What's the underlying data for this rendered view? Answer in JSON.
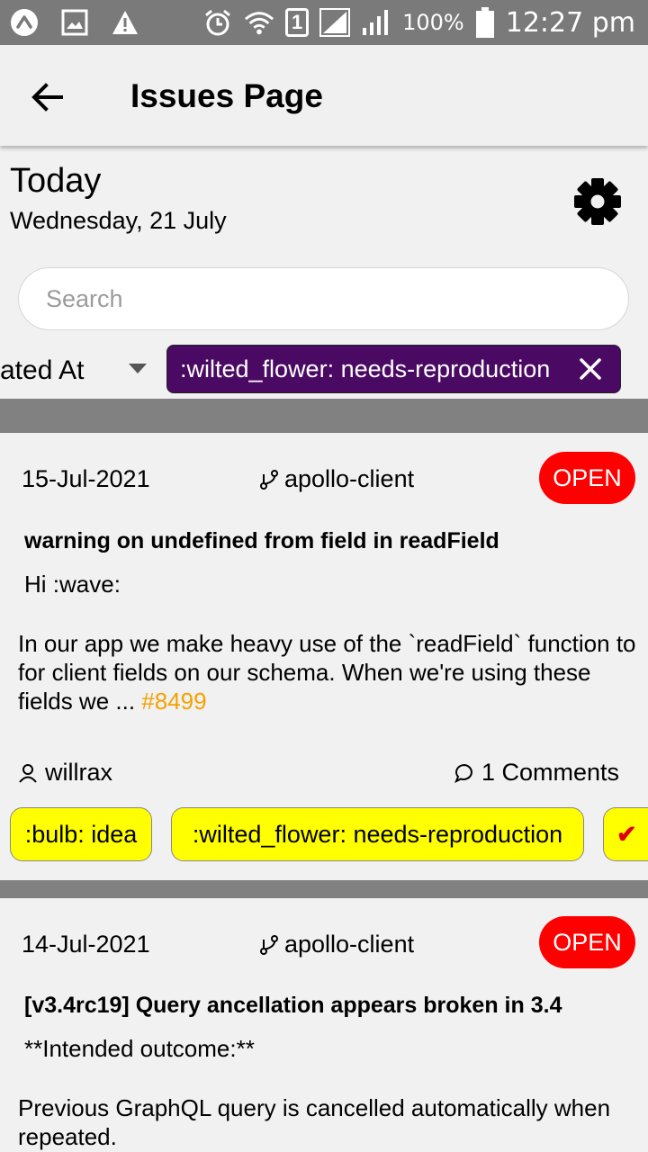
{
  "status_bar": {
    "battery": "100%",
    "sim": "1",
    "time": "12:27 pm",
    "icons": [
      "app-icon",
      "image-icon",
      "warning-icon",
      "alarm-icon",
      "wifi-icon",
      "sim-icon",
      "signal-icon",
      "signal-icon",
      "battery-icon"
    ]
  },
  "app_bar": {
    "title": "Issues Page",
    "back_icon": "arrow-left-icon"
  },
  "header": {
    "heading": "Today",
    "date": "Wednesday, 21 July",
    "settings_icon": "gear-icon"
  },
  "search": {
    "placeholder": "Search",
    "value": ""
  },
  "filters": {
    "sort_label": "ated At",
    "chip_label": ":wilted_flower: needs-reproduction",
    "chip_color": "#4a0a63"
  },
  "issues": [
    {
      "date": "15-Jul-2021",
      "repo": "apollo-client",
      "status": "OPEN",
      "title": "warning on undefined from field in readField",
      "greeting": "Hi :wave:",
      "body": "In our app we make heavy use of the `readField` function to for client fields on our schema. When we're using these fields we ...",
      "number": "#8499",
      "user": "willrax",
      "comments": "1 Comments",
      "labels": [
        ":bulb: idea",
        ":wilted_flower: needs-reproduction",
        "✔"
      ]
    },
    {
      "date": "14-Jul-2021",
      "repo": "apollo-client",
      "status": "OPEN",
      "title": "[v3.4rc19] Query ancellation appears broken in 3.4",
      "greeting": "**Intended outcome:**",
      "body": "Previous GraphQL query is cancelled automatically when repeated."
    }
  ],
  "colors": {
    "status_open": "#ff0000",
    "label_bg": "#ffff00",
    "issue_number": "#f5a100",
    "divider": "#818181"
  }
}
